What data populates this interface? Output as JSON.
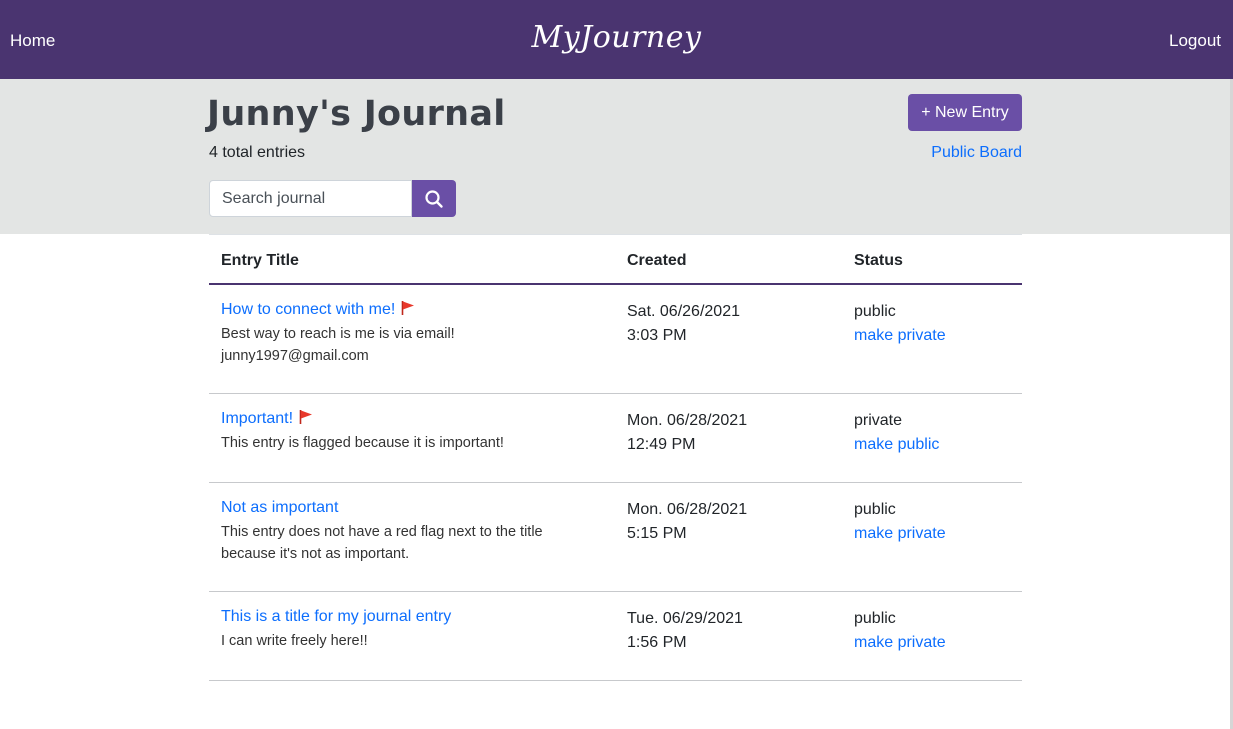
{
  "nav": {
    "home": "Home",
    "brand": "MyJourney",
    "logout": "Logout"
  },
  "header": {
    "title": "Junny's Journal",
    "entry_count": "4 total entries",
    "new_entry_label": "+ New Entry",
    "public_board": "Public Board",
    "search_placeholder": "Search journal"
  },
  "table": {
    "columns": [
      "Entry Title",
      "Created",
      "Status"
    ],
    "rows": [
      {
        "title": "How to connect with me!",
        "flagged": true,
        "desc_lines": [
          "Best way to reach is me is via email!",
          "junny1997@gmail.com"
        ],
        "date": "Sat. 06/26/2021",
        "time": "3:03 PM",
        "status": "public",
        "action": "make private"
      },
      {
        "title": "Important!",
        "flagged": true,
        "desc_lines": [
          "This entry is flagged because it is important!"
        ],
        "date": "Mon. 06/28/2021",
        "time": "12:49 PM",
        "status": "private",
        "action": "make public"
      },
      {
        "title": "Not as important",
        "flagged": false,
        "desc_lines": [
          "This entry does not have a red flag next to the title",
          "because it's not as important."
        ],
        "date": "Mon. 06/28/2021",
        "time": "5:15 PM",
        "status": "public",
        "action": "make private"
      },
      {
        "title": "This is a title for my journal entry",
        "flagged": false,
        "desc_lines": [
          "I can write freely here!!"
        ],
        "date": "Tue. 06/29/2021",
        "time": "1:56 PM",
        "status": "public",
        "action": "make private"
      }
    ]
  },
  "colors": {
    "nav_bg": "#4a3470",
    "button": "#6a4fa6",
    "link": "#0d6efd",
    "flag": "#e8382b",
    "header_bg": "#e3e5e4"
  },
  "icons": {
    "search": "search-icon",
    "flag": "flag-icon"
  }
}
